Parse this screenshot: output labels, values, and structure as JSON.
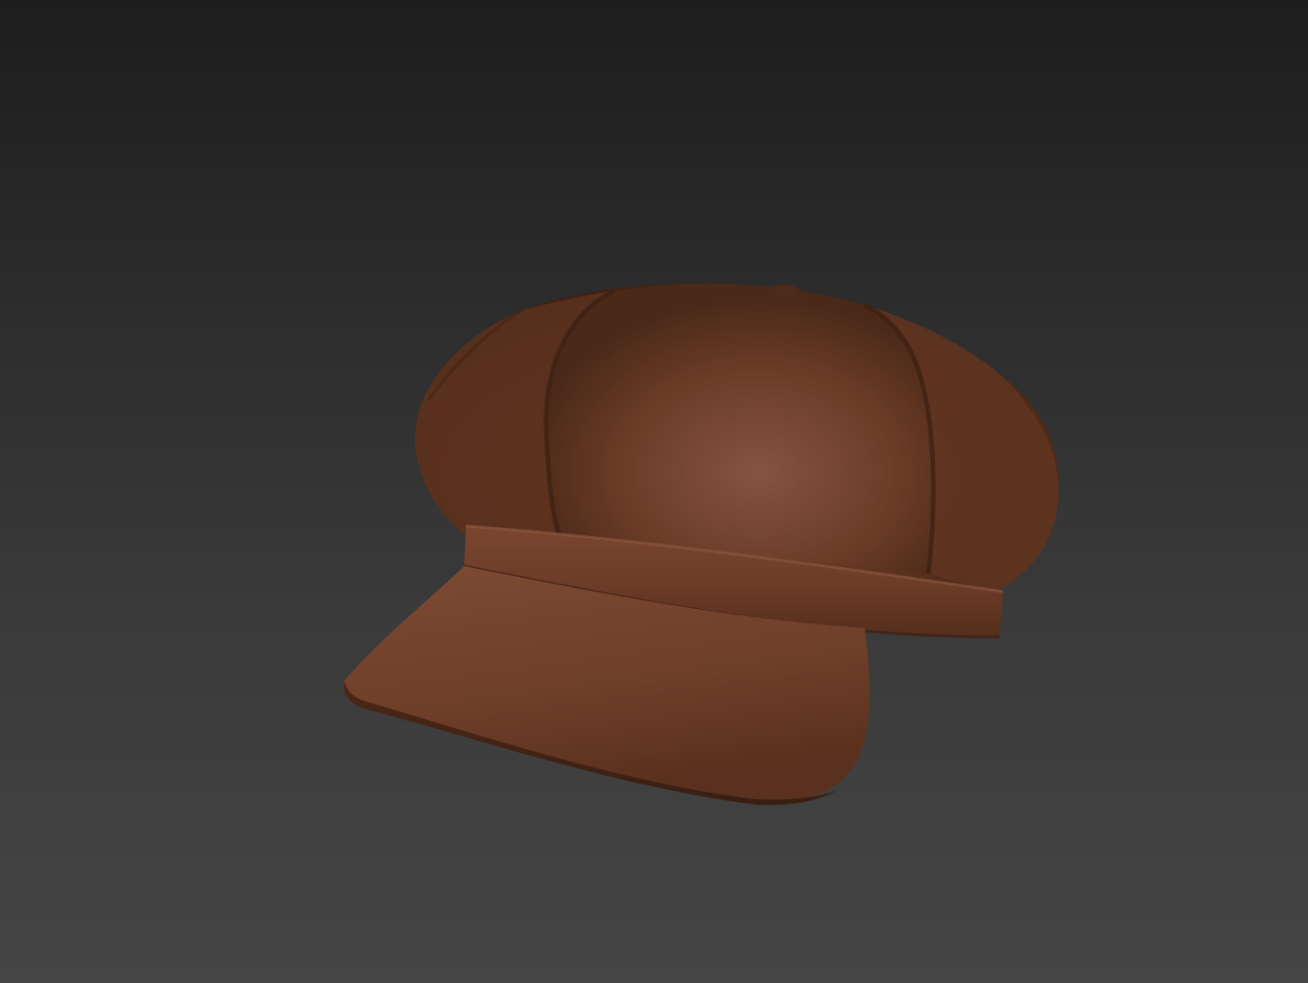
{
  "scene": {
    "background_top_color": "#1d1d1d",
    "background_bottom_color": "#454545",
    "model": {
      "subject": "newsboy-cap",
      "base_color": "#6e3f28",
      "highlight_color": "#8a5641",
      "shadow_color": "#3c2015"
    }
  }
}
